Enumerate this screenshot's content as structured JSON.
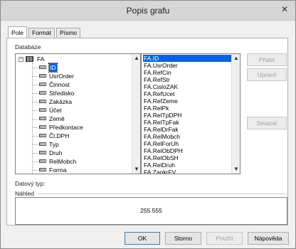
{
  "window": {
    "title": "Popis grafu",
    "close_glyph": "✕"
  },
  "tabs": [
    {
      "label": "Pole"
    },
    {
      "label": "Formát"
    },
    {
      "label": "Písmo"
    }
  ],
  "labels": {
    "databaze": "Databáze",
    "datovy_typ": "Datový typ:",
    "nahled": "Náhled"
  },
  "tree": {
    "root": {
      "label": "FA",
      "expander": "−"
    },
    "items": [
      {
        "label": "ID",
        "selected": true
      },
      {
        "label": "UsrOrder"
      },
      {
        "label": "Činnost"
      },
      {
        "label": "Středisko"
      },
      {
        "label": "Zakázka"
      },
      {
        "label": "Účet"
      },
      {
        "label": "Země"
      },
      {
        "label": "Předkontace"
      },
      {
        "label": "Čl.DPH"
      },
      {
        "label": "Typ"
      },
      {
        "label": "Druh"
      },
      {
        "label": "RelMobch"
      },
      {
        "label": "Forma"
      }
    ]
  },
  "field_list": [
    "FA.ID",
    "FA.UsrOrder",
    "FA.RefCin",
    "FA.RefStr",
    "FA.CisloZAK",
    "FA.RefUcet",
    "FA.RefZeme",
    "FA.RelPk",
    "FA.RelTpDPH",
    "FA.RelTpFak",
    "FA.RelDrFak",
    "FA.RelMobch",
    "FA.RelForUh",
    "FA.RelObDPH",
    "FA.RelObSH",
    "FA.RelDruh",
    "FA.ZaokrFV"
  ],
  "side_buttons": {
    "pridat": "Přidat",
    "upravit": "Upravit",
    "smazat": "Smazat"
  },
  "preview_value": "255 555",
  "footer_buttons": {
    "ok": "OK",
    "storno": "Storno",
    "pouzit": "Použít",
    "napoveda": "Nápověda"
  },
  "colors": {
    "selection": "#0a64d8",
    "titlebar": "#d6d6d6"
  }
}
